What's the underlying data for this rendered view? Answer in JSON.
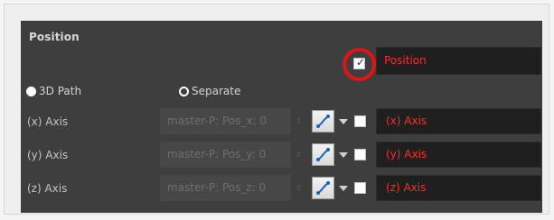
{
  "panel": {
    "title": "Position",
    "enable_checked": true,
    "position_field": "Position"
  },
  "path_mode": {
    "options": [
      {
        "label": "3D Path",
        "selected": true
      },
      {
        "label": "Separate",
        "selected": false
      }
    ]
  },
  "axes": [
    {
      "label": "(x) Axis",
      "value": "master-P: Pos_x: 0",
      "red_label": "(x) Axis",
      "checked": false
    },
    {
      "label": "(y) Axis",
      "value": "master-P: Pos_y: 0",
      "red_label": "(y) Axis",
      "checked": false
    },
    {
      "label": "(z) Axis",
      "value": "master-P: Pos_z: 0",
      "red_label": "(z) Axis",
      "checked": false
    }
  ],
  "colors": {
    "panel_bg": "#3e3e3e",
    "accent_red": "#ff2a2a",
    "highlight_ring": "#e01414"
  },
  "icons": {
    "function_curve": "function-curve-icon",
    "dropdown": "chevron-down-icon",
    "spinner": "spinner-arrows-icon",
    "check": "checkmark-icon"
  }
}
